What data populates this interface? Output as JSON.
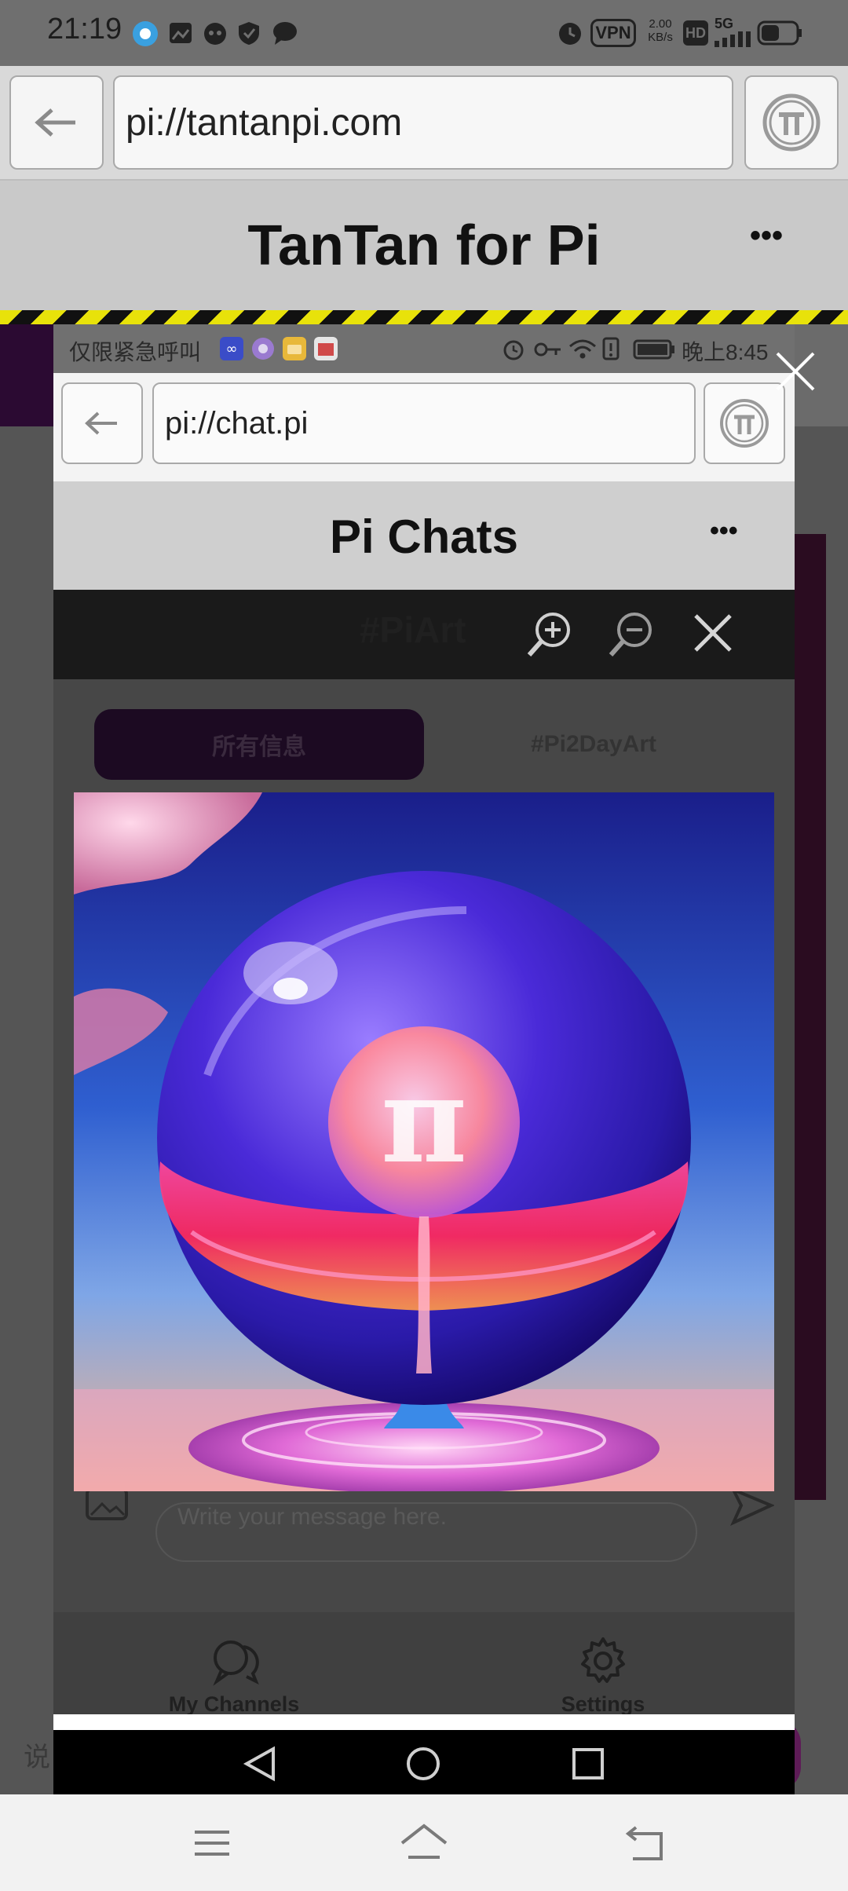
{
  "status_bar": {
    "time": "21:19",
    "net_speed": "2.00",
    "net_unit": "KB/s",
    "vpn": "VPN",
    "hd": "HD",
    "signal": "5G"
  },
  "outer_browser": {
    "url": "pi://tantanpi.com",
    "page_title": "TanTan for Pi",
    "more": "•••"
  },
  "inner_status_bar": {
    "carrier_text": "仅限紧急呼叫",
    "time": "晚上8:45"
  },
  "inner_browser": {
    "url": "pi://chat.pi",
    "page_title": "Pi Chats",
    "more": "•••"
  },
  "image_viewer": {
    "title": "#PiArt"
  },
  "chat": {
    "tabs": [
      {
        "label": "所有信息",
        "active": true
      },
      {
        "label": "#Pi2DayArt",
        "active": false
      }
    ],
    "message_placeholder": "Write your message here.",
    "bottom_nav": [
      {
        "label": "My Channels",
        "icon": "chat-bubbles-icon"
      },
      {
        "label": "Settings",
        "icon": "gear-icon"
      }
    ]
  },
  "background_page": {
    "partial_text": "说"
  },
  "colors": {
    "hazard_yellow": "#e8e20a",
    "purple_accent": "#2b0a32",
    "tab_active": "#1c0a22"
  }
}
